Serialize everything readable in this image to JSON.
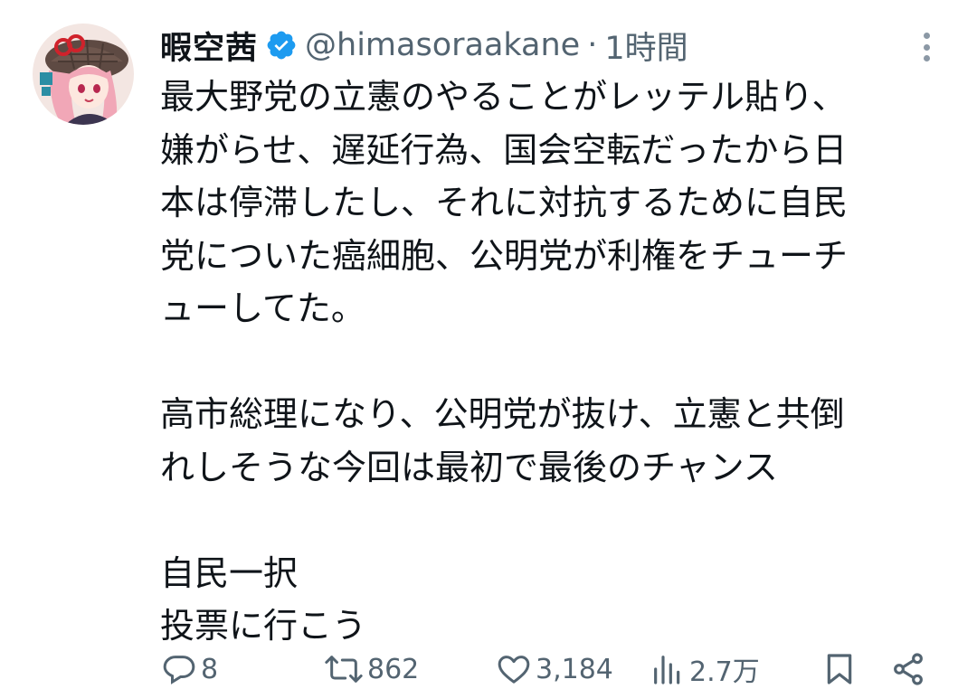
{
  "tweet": {
    "display_name": "暇空茜",
    "handle": "@himasoraakane",
    "separator": "·",
    "time": "1時間",
    "lines": [
      "最大野党の立憲のやることがレッテル貼り、",
      "嫌がらせ、遅延行為、国会空転だったから日",
      "本は停滞したし、それに対抗するために自民",
      "党についた癌細胞、公明党が利権をチューチ",
      "ューしてた。",
      "",
      "高市総理になり、公明党が抜け、立憲と共倒",
      "れしそうな今回は最初で最後のチャンス",
      "",
      "自民一択",
      "投票に行こう"
    ]
  },
  "icons": {
    "verified": "verified-badge-icon",
    "more": "more-options-icon",
    "reply": "reply-icon",
    "retweet": "retweet-icon",
    "like": "like-icon",
    "views": "views-icon",
    "bookmark": "bookmark-icon",
    "share": "share-icon"
  },
  "actions": {
    "replies": "8",
    "retweets": "862",
    "likes": "3,184",
    "views": "2.7万"
  },
  "colors": {
    "text": "#0f1419",
    "secondary": "#536471",
    "verified": "#1d9bf0",
    "more_dots": "#8b98a5"
  }
}
